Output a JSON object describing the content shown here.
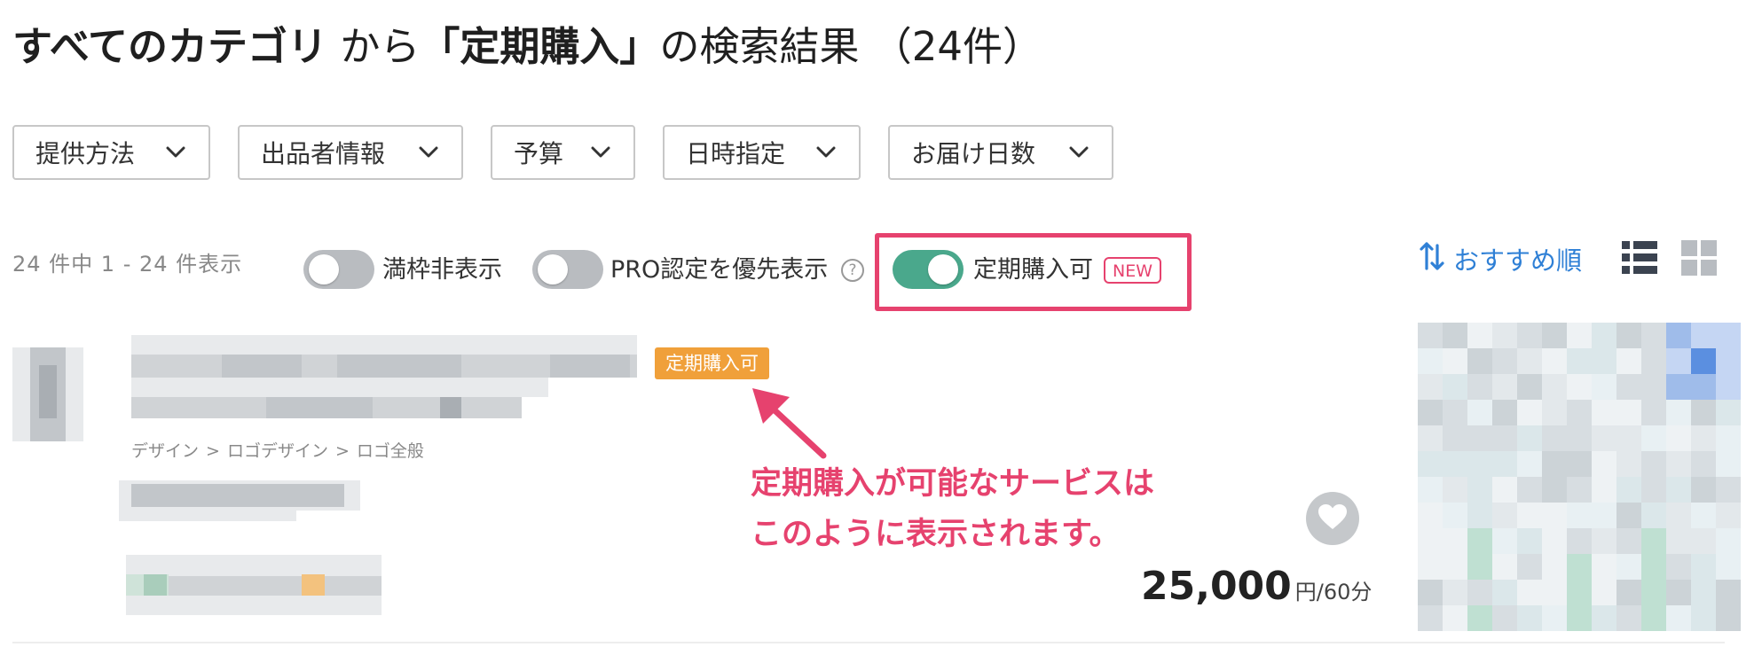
{
  "title": {
    "category": "すべてのカテゴリ",
    "from": "から",
    "query_open": "「",
    "query": "定期購入",
    "query_close": "」",
    "suffix": "の検索結果",
    "count": "（24件）"
  },
  "filters": [
    {
      "label": "提供方法"
    },
    {
      "label": "出品者情報"
    },
    {
      "label": "予算"
    },
    {
      "label": "日時指定"
    },
    {
      "label": "お届け日数"
    }
  ],
  "toolbar": {
    "result_count": "24 件中 1 - 24 件表示",
    "toggle_full": {
      "label": "満枠非表示",
      "on": false
    },
    "toggle_pro": {
      "label": "PRO認定を優先表示",
      "on": false
    },
    "help_glyph": "?",
    "toggle_subscription": {
      "label": "定期購入可",
      "on": true
    },
    "new_badge": "NEW",
    "sort_label": "おすすめ順",
    "view_modes": [
      "list-view-icon",
      "grid-view-icon"
    ]
  },
  "result": {
    "tag": "定期購入可",
    "breadcrumb": [
      "デザイン",
      "ロゴデザイン",
      "ロゴ全般"
    ],
    "breadcrumb_sep": ">",
    "price": "25,000",
    "price_unit": "円/60分"
  },
  "annotation": {
    "line1": "定期購入が可能なサービスは",
    "line2": "このように表示されます。"
  },
  "colors": {
    "accent_pink": "#e6426e",
    "toggle_on": "#4aa88c",
    "tag_orange": "#f0a03a",
    "link_blue": "#2f80d6"
  }
}
